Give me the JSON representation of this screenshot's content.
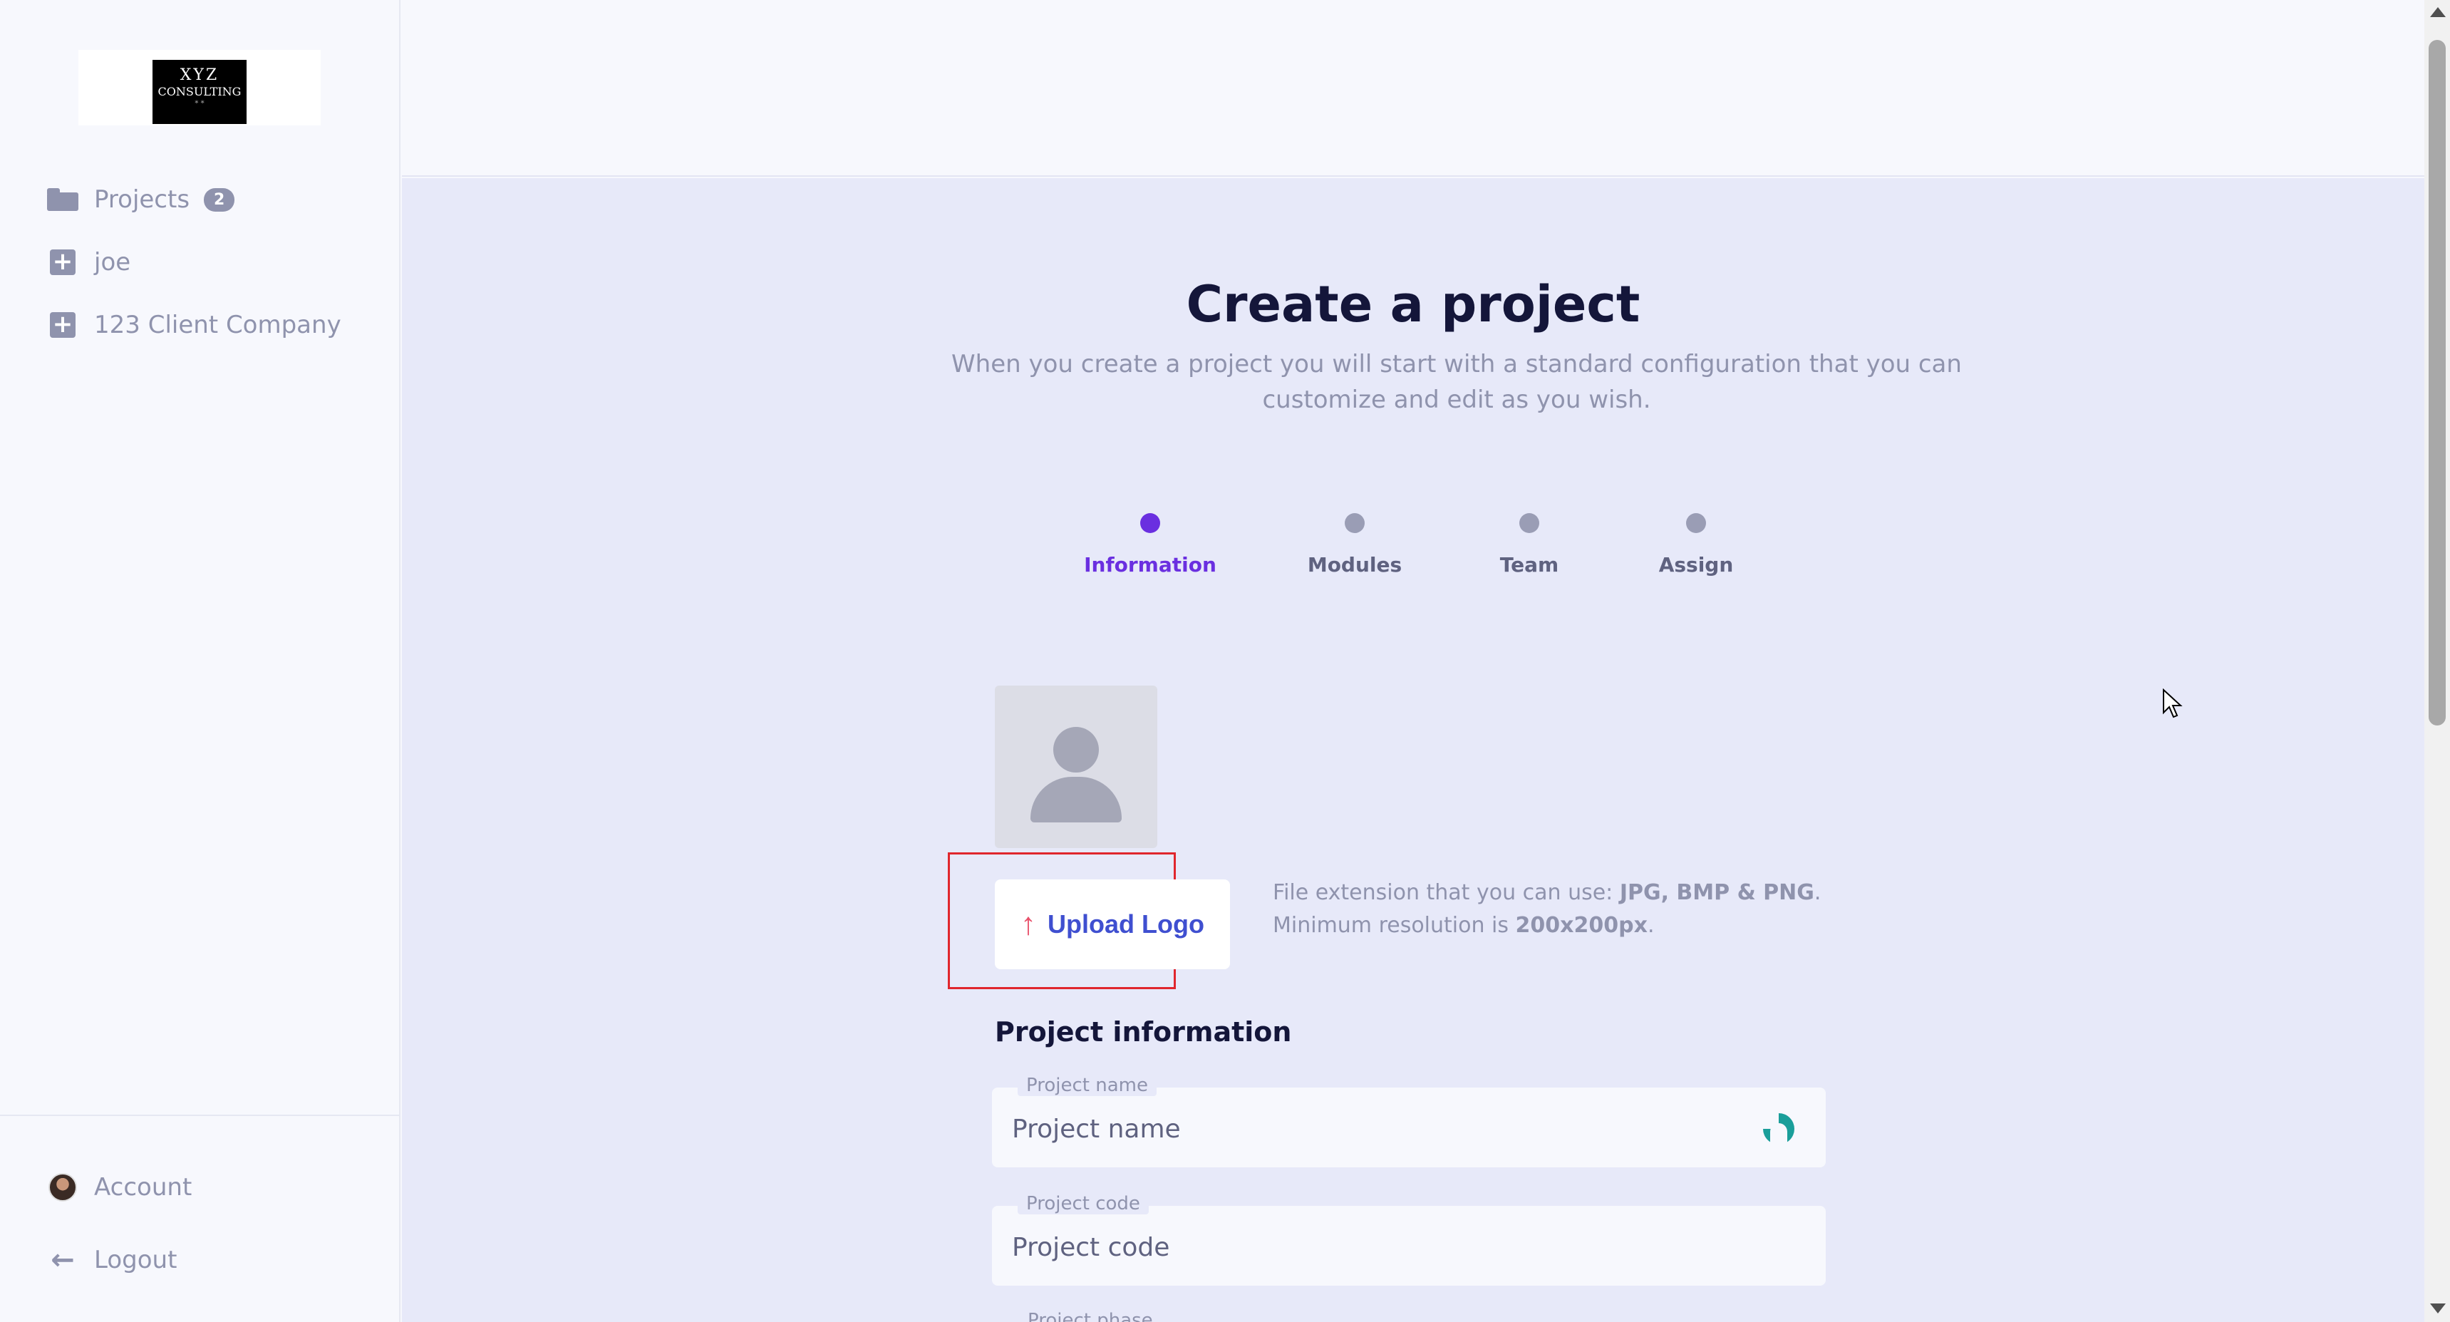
{
  "sidebar": {
    "logo": {
      "line1": "XYZ",
      "line2": "CONSULTING",
      "line3": "* *"
    },
    "items": [
      {
        "label": "Projects",
        "icon": "folder-open-icon",
        "badge": "2"
      },
      {
        "label": "joe",
        "icon": "plus-square-icon"
      },
      {
        "label": "123 Client Company",
        "icon": "plus-square-icon"
      }
    ],
    "footer": [
      {
        "label": "Account",
        "icon": "avatar"
      },
      {
        "label": "Logout",
        "icon": "arrow-left-icon"
      }
    ]
  },
  "main": {
    "title": "Create a project",
    "subtitle": "When you create a project you will start with a standard configuration that you can customize and edit as you wish.",
    "steps": [
      {
        "label": "Information",
        "active": true
      },
      {
        "label": "Modules",
        "active": false
      },
      {
        "label": "Team",
        "active": false
      },
      {
        "label": "Assign",
        "active": false
      }
    ],
    "upload": {
      "button_label": "Upload Logo",
      "hint_prefix": "File extension that you can use: ",
      "hint_formats": "JPG, BMP & PNG",
      "hint_mid": "Minimum resolution is ",
      "hint_resolution": "200x200px"
    },
    "section_title": "Project information",
    "fields": [
      {
        "label": "Project name",
        "placeholder": "Project name",
        "value": ""
      },
      {
        "label": "Project code",
        "placeholder": "Project code",
        "value": ""
      }
    ],
    "next_field_label": "Project phase"
  },
  "colors": {
    "accent": "#6a2fe0",
    "upload_text": "#3f4fd0",
    "upload_arrow": "#e8506a",
    "highlight": "#e0262d",
    "muted": "#8f93ad",
    "main_bg": "#e7e9f9"
  }
}
